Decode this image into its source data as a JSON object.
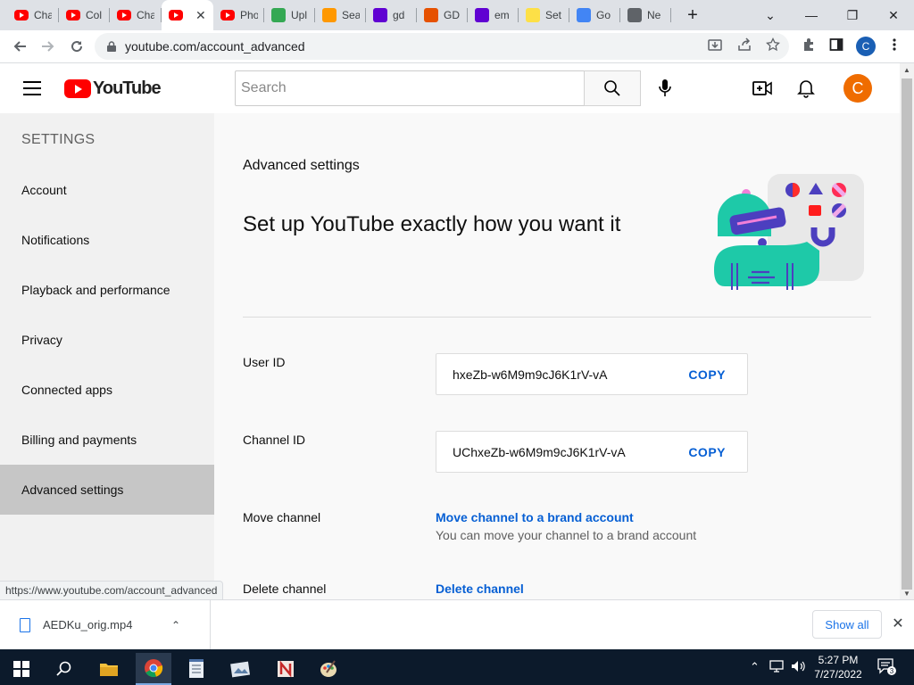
{
  "browser": {
    "tabs": [
      {
        "title": "Cha",
        "icon": "youtube-icon",
        "color": "#ff0000"
      },
      {
        "title": "Col",
        "icon": "youtube-icon",
        "color": "#ff0000"
      },
      {
        "title": "Cha",
        "icon": "youtube-icon",
        "color": "#ff0000"
      },
      {
        "title": "",
        "icon": "youtube-icon",
        "color": "#ff0000",
        "active": true
      },
      {
        "title": "Pho",
        "icon": "youtube-icon",
        "color": "#ff0000"
      },
      {
        "title": "Upl",
        "icon": "upload-icon",
        "color": "#34a853"
      },
      {
        "title": "Sea",
        "icon": "person-icon",
        "color": "#ff9800"
      },
      {
        "title": "gd",
        "icon": "yahoo-icon",
        "color": "#6001d2"
      },
      {
        "title": "GD",
        "icon": "paint-icon",
        "color": "#e65100"
      },
      {
        "title": "em",
        "icon": "yahoo-icon",
        "color": "#6001d2"
      },
      {
        "title": "Set",
        "icon": "e-icon",
        "color": "#fde047"
      },
      {
        "title": "Go",
        "icon": "google-icon",
        "color": "#4285f4"
      },
      {
        "title": "Ne",
        "icon": "globe-icon",
        "color": "#5f6368"
      }
    ],
    "url": "youtube.com/account_advanced",
    "profile_initial": "C",
    "status_url": "https://www.youtube.com/account_advanced"
  },
  "youtube": {
    "logo_text": "YouTube",
    "search_placeholder": "Search",
    "avatar_initial": "C",
    "avatar_color": "#ef6c00"
  },
  "sidebar": {
    "heading": "SETTINGS",
    "items": [
      {
        "label": "Account"
      },
      {
        "label": "Notifications"
      },
      {
        "label": "Playback and performance"
      },
      {
        "label": "Privacy"
      },
      {
        "label": "Connected apps"
      },
      {
        "label": "Billing and payments"
      },
      {
        "label": "Advanced settings",
        "selected": true
      }
    ]
  },
  "main": {
    "section_title": "Advanced settings",
    "hero": "Set up YouTube exactly how you want it",
    "user_id": {
      "label": "User ID",
      "value": "hxeZb-w6M9m9cJ6K1rV-vA",
      "action": "COPY"
    },
    "channel_id": {
      "label": "Channel ID",
      "value": "UChxeZb-w6M9m9cJ6K1rV-vA",
      "action": "COPY"
    },
    "move_channel": {
      "label": "Move channel",
      "link": "Move channel to a brand account",
      "description": "You can move your channel to a brand account"
    },
    "delete_channel": {
      "label": "Delete channel",
      "link": "Delete channel"
    }
  },
  "download_bar": {
    "filename": "AEDKu_orig.mp4",
    "show_all": "Show all"
  },
  "taskbar": {
    "time": "5:27 PM",
    "date": "7/27/2022",
    "notification_count": "3"
  }
}
